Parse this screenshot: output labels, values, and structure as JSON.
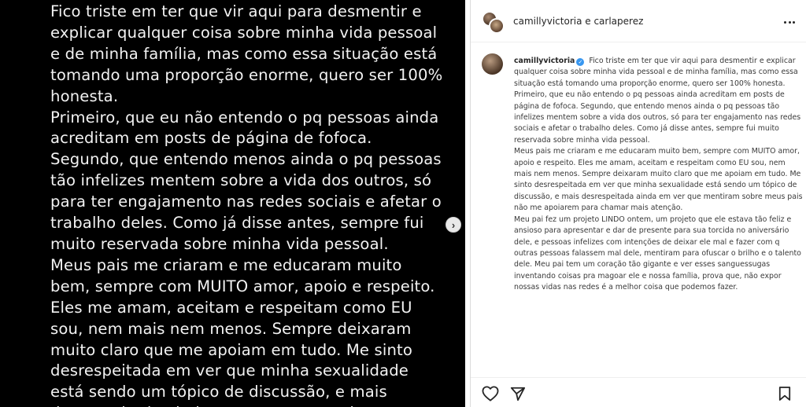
{
  "story": {
    "paragraphs": [
      "Fico triste em ter que vir aqui para desmentir e explicar qualquer coisa sobre minha vida pessoal e de minha família, mas como essa situação está tomando uma proporção enorme, quero ser 100% honesta.",
      "Primeiro, que eu não entendo o pq pessoas ainda acreditam em posts de página de fofoca. Segundo, que entendo menos ainda o pq pessoas tão infelizes mentem sobre a vida dos outros, só para ter engajamento nas redes sociais e afetar o trabalho deles. Como já disse antes, sempre fui muito reservada sobre minha vida pessoal.",
      "Meus pais me criaram e me educaram muito bem, sempre com MUITO amor, apoio e respeito. Eles me amam, aceitam e respeitam como EU sou, nem mais nem menos. Sempre deixaram muito claro que me apoiam em tudo. Me sinto desrespeitada em ver que minha sexualidade está sendo um tópico de discussão, e mais desrespeitada ainda em ver que mentiram"
    ],
    "next_icon": "chevron-right-icon"
  },
  "post": {
    "header_names": "camillyvictoria e carlaperez",
    "more_icon": "more-options-icon",
    "caption_user": "camillyvictoria",
    "verified_icon": "verified-badge-icon",
    "caption_first": "Fico triste em ter que vir aqui para desmentir e explicar qualquer coisa sobre minha vida pessoal e de minha família, mas como essa situação está tomando uma proporção enorme, quero ser 100% honesta.",
    "caption_paragraphs": [
      "Primeiro, que eu não entendo o pq pessoas ainda acreditam em posts de página de fofoca. Segundo, que entendo menos ainda o pq pessoas tão infelizes mentem sobre a vida dos outros, só para ter engajamento nas redes sociais e afetar o trabalho deles. Como já disse antes, sempre fui muito reservada sobre minha vida pessoal.",
      "Meus pais me criaram e me educaram muito bem, sempre com MUITO amor, apoio e respeito. Eles me amam, aceitam e respeitam como EU sou, nem mais nem menos. Sempre deixaram muito claro que me apoiam em tudo. Me sinto desrespeitada em ver que minha sexualidade está sendo um tópico de discussão, e mais desrespeitada ainda em ver que mentiram sobre meus pais não me apoiarem para chamar mais atenção.",
      "Meu pai fez um projeto LINDO ontem, um projeto que ele estava tão feliz e ansioso para apresentar e dar de presente para sua torcida no aniversário dele, e pessoas infelizes com intenções de deixar ele mal e fazer com q outras pessoas falassem mal dele, mentiram para ofuscar o brilho e o talento dele. Meu pai tem um coração tão gigante e ver esses sanguessugas inventando coisas pra magoar ele e nossa família, prova que, não expor nossas vidas nas redes é a melhor coisa que podemos fazer."
    ]
  },
  "actions": {
    "like_icon": "heart-icon",
    "share_icon": "send-icon",
    "save_icon": "bookmark-icon"
  }
}
